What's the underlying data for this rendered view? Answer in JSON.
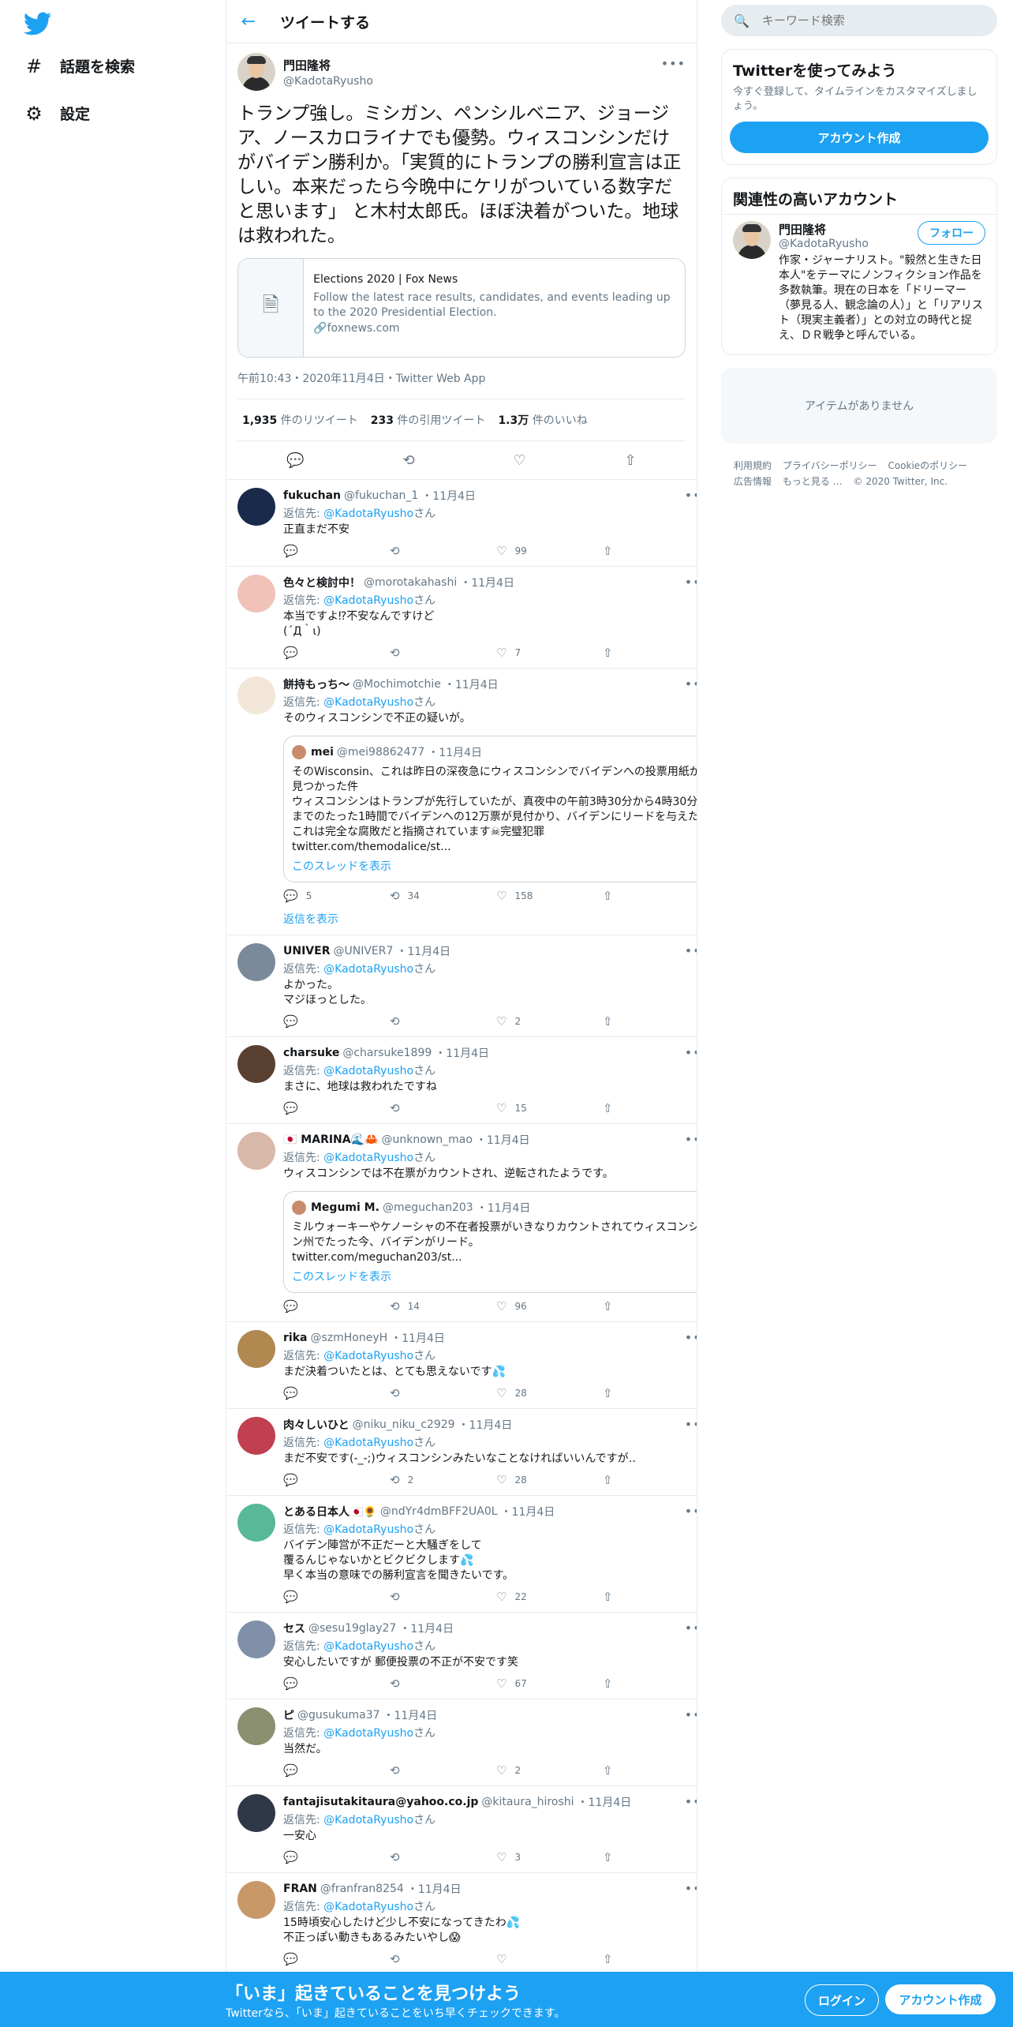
{
  "nav": {
    "items": [
      {
        "label": "話題を検索",
        "icon": "hash-icon"
      },
      {
        "label": "設定",
        "icon": "gear-icon"
      }
    ]
  },
  "header": {
    "title": "ツイートする"
  },
  "main_post": {
    "name": "門田隆将",
    "handle": "@KadotaRyusho",
    "text": "トランプ強し。ミシガン、ペンシルベニア、ジョージア、ノースカロライナでも優勢。ウィスコンシンだけがバイデン勝利か。「実質的にトランプの勝利宣言は正しい。本来だったら今晩中にケリがついている数字だと思います」 と木村太郎氏。ほぼ決着がついた。地球は救われた。",
    "card": {
      "title": "Elections 2020 | Fox News",
      "desc": "Follow the latest race results, candidates, and events leading up to the 2020 Presidential Election.",
      "link": "foxnews.com"
    },
    "meta": "午前10:43・2020年11月4日・Twitter Web App",
    "stats": {
      "retweets_num": "1,935",
      "retweets_label": " 件のリツイート",
      "quotes_num": "233",
      "quotes_label": " 件の引用ツイート",
      "likes_num": "1.3万",
      "likes_label": " 件のいいね"
    }
  },
  "reply_to_label": "返信先: ",
  "reply_to_link": "@KadotaRyusho",
  "reply_to_suffix": "さん",
  "replies": [
    {
      "name": "fukuchan",
      "handle": "@fukuchan_1",
      "date": "・11月4日",
      "text": "正直まだ不安",
      "reply": "",
      "rt": "",
      "like": "99",
      "color": "#1a2a4a"
    },
    {
      "name": "色々と検討中！",
      "handle": "@morotakahashi",
      "date": "・11月4日",
      "text": "本当ですよ⁉︎不安なんですけど\n(´Д｀ι)",
      "reply": "",
      "rt": "",
      "like": "7",
      "color": "#f0c2b8"
    },
    {
      "name": "餅持もっち〜",
      "handle": "@Mochimotchie",
      "date": "・11月4日",
      "text": "そのウィスコンシンで不正の疑いが。",
      "reply": "5",
      "rt": "34",
      "like": "158",
      "color": "#f2e6d8",
      "quote": {
        "name": "mei",
        "handle": "@mei98862477",
        "date": "・11月4日",
        "text": "そのWisconsin、これは昨日の深夜急にウィスコンシンでバイデンへの投票用紙が見つかった件\nウィスコンシンはトランプが先行していたが、真夜中の午前3時30分から4時30分までのたった1時間でバイデンへの12万票が見付かり、バイデンにリードを与えた\nこれは完全な腐敗だと指摘されています☠完璧犯罪\ntwitter.com/themodalice/st...",
        "link": "このスレッドを表示"
      },
      "show_more": "返信を表示"
    },
    {
      "name": "UNIVER",
      "handle": "@UNIVER7",
      "date": "・11月4日",
      "text": "よかった。\nマジほっとした。",
      "reply": "",
      "rt": "",
      "like": "2",
      "color": "#7a8a9a"
    },
    {
      "name": "charsuke",
      "handle": "@charsuke1899",
      "date": "・11月4日",
      "text": "まさに、地球は救われたですね",
      "reply": "",
      "rt": "",
      "like": "15",
      "color": "#5a4030"
    },
    {
      "name": "🇯🇵 MARINA🌊🦀",
      "handle": "@unknown_mao",
      "date": "・11月4日",
      "text": "ウィスコンシンでは不在票がカウントされ、逆転されたようです。",
      "reply": "",
      "rt": "14",
      "like": "96",
      "color": "#d8b8a8",
      "quote": {
        "name": "Megumi M.",
        "handle": "@meguchan203",
        "date": "・11月4日",
        "text": "ミルウォーキーやケノーシャの不在者投票がいきなりカウントされてウィスコンシン州でたった今、バイデンがリード。\ntwitter.com/meguchan203/st...",
        "link": "このスレッドを表示"
      }
    },
    {
      "name": "rika",
      "handle": "@szmHoneyH",
      "date": "・11月4日",
      "text": "まだ決着ついたとは、とても思えないです💦",
      "reply": "",
      "rt": "",
      "like": "28",
      "color": "#b08850"
    },
    {
      "name": "肉々しいひと",
      "handle": "@niku_niku_c2929",
      "date": "・11月4日",
      "text": "まだ不安です(-_-;)ウィスコンシンみたいなことなければいいんですが‥",
      "reply": "",
      "rt": "2",
      "like": "28",
      "color": "#c04050"
    },
    {
      "name": "とある日本人🇯🇵🌻",
      "handle": "@ndYr4dmBFF2UA0L",
      "date": "・11月4日",
      "text": "バイデン陣営が不正だーと大騒ぎをして\n覆るんじゃないかとビクビクします💦\n早く本当の意味での勝利宣言を聞きたいです。",
      "reply": "",
      "rt": "",
      "like": "22",
      "color": "#58b898"
    },
    {
      "name": "セス",
      "handle": "@sesu19glay27",
      "date": "・11月4日",
      "text": "安心したいですが 郵便投票の不正が不安です笑",
      "reply": "",
      "rt": "",
      "like": "67",
      "color": "#8090a8"
    },
    {
      "name": "ピ",
      "handle": "@gusukuma37",
      "date": "・11月4日",
      "text": "当然だ。",
      "reply": "",
      "rt": "",
      "like": "2",
      "color": "#8a9070"
    },
    {
      "name": "fantajisutakitaura@yahoo.co.jp",
      "handle": "@kitaura_hiroshi",
      "date": "・11月4日",
      "text": "一安心",
      "reply": "",
      "rt": "",
      "like": "3",
      "color": "#303848"
    },
    {
      "name": "FRAN",
      "handle": "@franfran8254",
      "date": "・11月4日",
      "text": "15時頃安心したけど少し不安になってきたわ💦\n不正っぽい動きもあるみたいやし😱",
      "reply": "",
      "rt": "",
      "like": "",
      "color": "#c89868"
    }
  ],
  "right": {
    "search_placeholder": "キーワード検索",
    "signup_panel": {
      "title": "Twitterを使ってみよう",
      "sub": "今すぐ登録して、タイムラインをカスタマイズしましょう。",
      "button": "アカウント作成"
    },
    "related": {
      "title": "関連性の高いアカウント",
      "name": "門田隆将",
      "handle": "@KadotaRyusho",
      "follow": "フォロー",
      "bio": "作家・ジャーナリスト。\"毅然と生きた日本人\"をテーマにノンフィクション作品を多数執筆。現在の日本を「ドリーマー（夢見る人、観念論の人）」と「リアリスト（現実主義者）」との対立の時代と捉え、ＤＲ戦争と呼んでいる。"
    },
    "empty": "アイテムがありません",
    "footer": [
      "利用規約",
      "プライバシーポリシー",
      "Cookieのポリシー",
      "広告情報",
      "もっと見る …",
      "© 2020 Twitter, Inc."
    ]
  },
  "bottom": {
    "title": "「いま」起きていることを見つけよう",
    "sub": "Twitterなら、「いま」起きていることをいち早くチェックできます。",
    "login": "ログイン",
    "signup": "アカウント作成"
  },
  "colors": {
    "accent": "#1da1f2",
    "muted": "#657786",
    "border": "#e6ecf0"
  }
}
